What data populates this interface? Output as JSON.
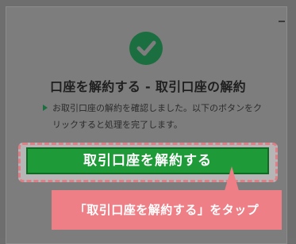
{
  "dialog": {
    "title": "口座を解約する - 取引口座の解約",
    "message": "お取引口座の解約を確認しました。以下のボタンをクリックすると処理を完了します。",
    "primary_button_label": "取引口座を解約する"
  },
  "annotation": {
    "callout_text": "「取引口座を解約する」をタップ"
  },
  "colors": {
    "success": "#1b6e3f",
    "button": "#1f9a38",
    "callout": "#ef7f86",
    "highlight_border": "#e07d85"
  },
  "icons": {
    "status": "check-icon",
    "window_control": "minimize-icon",
    "bullet": "triangle-bullet-icon"
  }
}
